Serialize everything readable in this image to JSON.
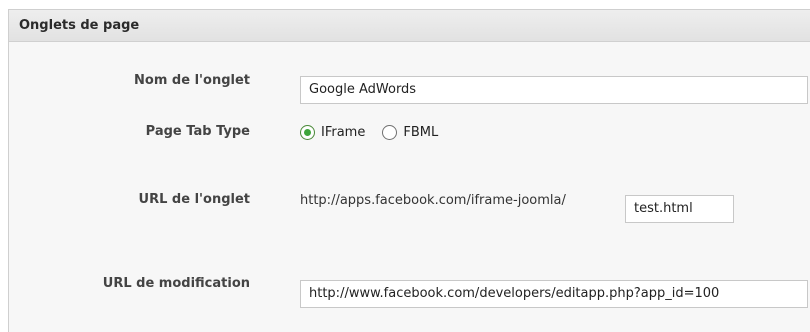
{
  "panel": {
    "title": "Onglets de page"
  },
  "fields": {
    "tab_name": {
      "label": "Nom de l'onglet",
      "value": "Google AdWords"
    },
    "tab_type": {
      "label": "Page Tab Type",
      "options": [
        "IFrame",
        "FBML"
      ],
      "selected": "IFrame"
    },
    "tab_url": {
      "label": "URL de l'onglet",
      "prefix": "http://apps.facebook.com/iframe-joomla/",
      "value": "test.html"
    },
    "edit_url": {
      "label": "URL de modification",
      "value": "http://www.facebook.com/developers/editapp.php?app_id=100"
    }
  },
  "colors": {
    "panel_bg": "#f7f7f7",
    "header_bg": "#e6e6e6",
    "radio_selected": "#3da53a"
  }
}
